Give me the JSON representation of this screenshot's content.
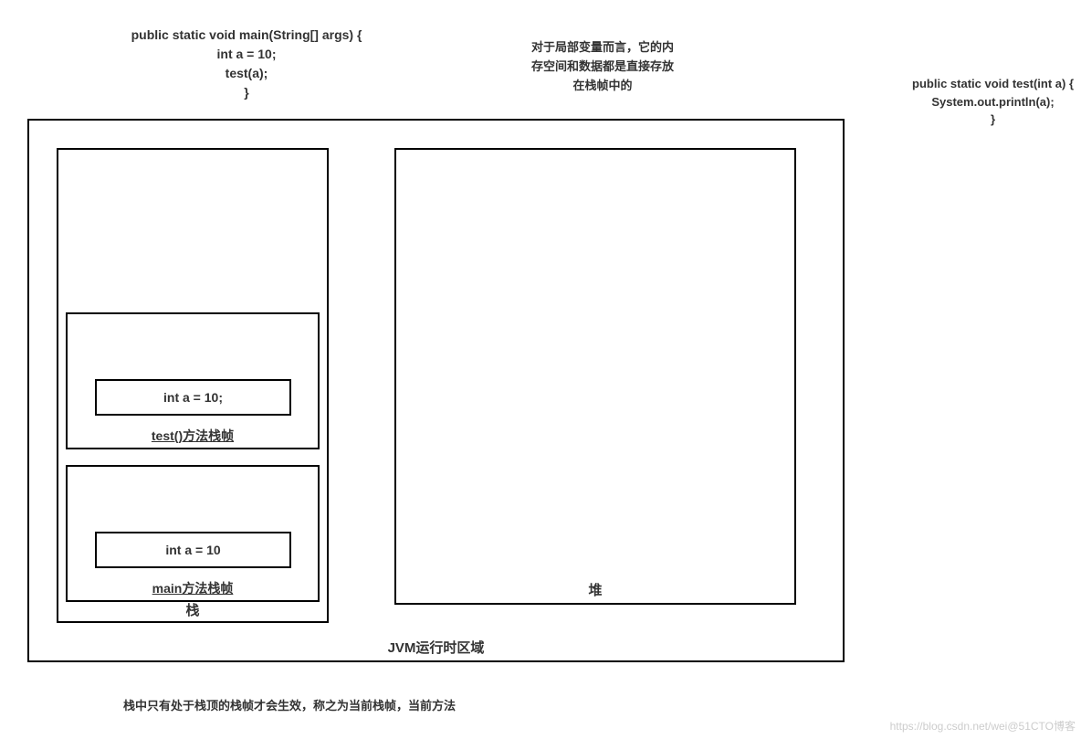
{
  "code_main": {
    "line1": "public static void main(String[] args) {",
    "line2": "int a = 10;",
    "line3": "test(a);",
    "line4": "}"
  },
  "annotation": {
    "line1": "对于局部变量而言，它的内",
    "line2": "存空间和数据都是直接存放",
    "line3": "在栈帧中的"
  },
  "code_test": {
    "line1": "public static void test(int a) {",
    "line2": "System.out.println(a);",
    "line3": "}"
  },
  "jvm": {
    "label": "JVM运行时区域",
    "stack": {
      "label": "栈",
      "frame_test": {
        "label": "test()方法栈帧",
        "var": "int a = 10;"
      },
      "frame_main": {
        "label": "main方法栈帧",
        "var": "int a = 10"
      }
    },
    "heap": {
      "label": "堆"
    }
  },
  "footnote": "栈中只有处于栈顶的栈帧才会生效，称之为当前栈帧，当前方法",
  "watermark": "https://blog.csdn.net/wei@51CTO博客"
}
